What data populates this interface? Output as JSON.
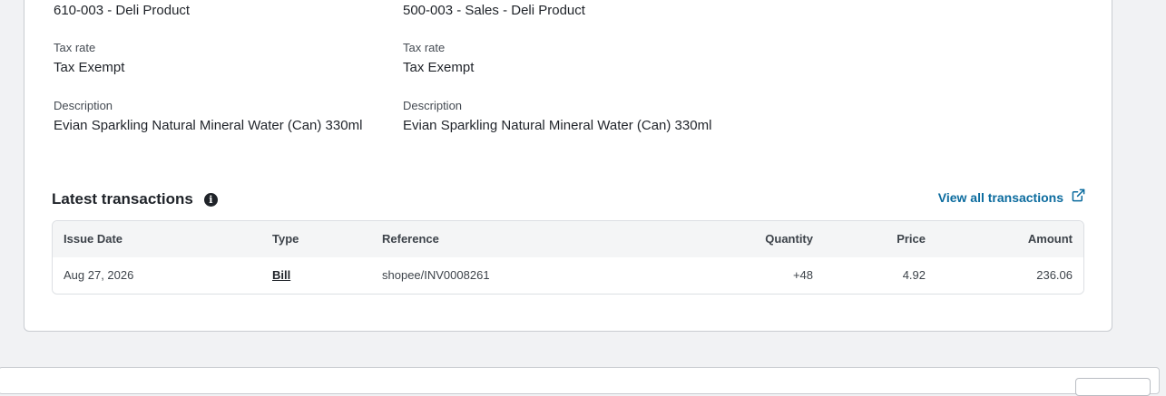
{
  "purchase": {
    "account_value": "610-003 - Deli Product",
    "tax_label": "Tax rate",
    "tax_value": "Tax Exempt",
    "desc_label": "Description",
    "desc_value": "Evian Sparkling Natural Mineral Water (Can) 330ml"
  },
  "sales": {
    "account_value": "500-003 - Sales - Deli Product",
    "tax_label": "Tax rate",
    "tax_value": "Tax Exempt",
    "desc_label": "Description",
    "desc_value": "Evian Sparkling Natural Mineral Water (Can) 330ml"
  },
  "transactions": {
    "title": "Latest transactions",
    "view_all": "View all transactions",
    "headers": {
      "issue_date": "Issue Date",
      "type": "Type",
      "reference": "Reference",
      "quantity": "Quantity",
      "price": "Price",
      "amount": "Amount"
    },
    "rows": [
      {
        "issue_date": "Aug 27, 2026",
        "type": "Bill",
        "reference": "shopee/INV0008261",
        "quantity": "+48",
        "price": "4.92",
        "amount": "236.06"
      }
    ]
  },
  "colors": {
    "link": "#0b6b9e",
    "page_bg": "#f1f2f4"
  }
}
